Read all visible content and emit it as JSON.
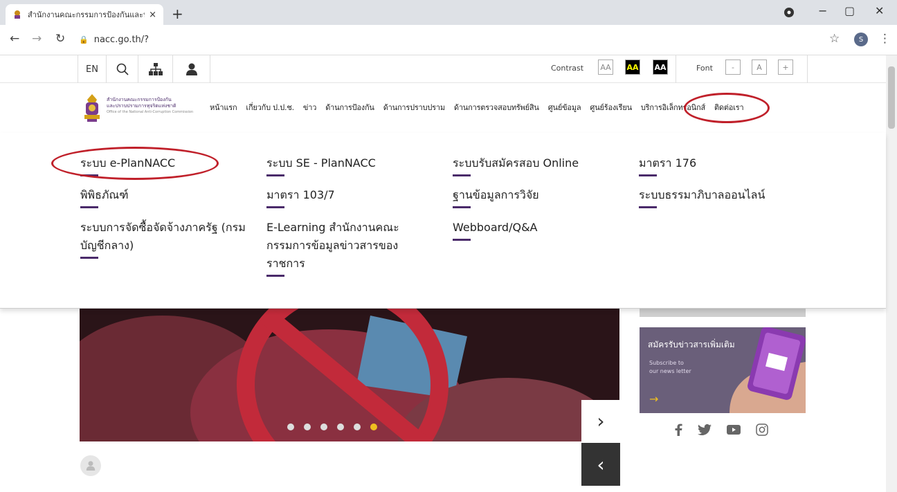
{
  "browser": {
    "tab_title": "สำนักงานคณะกรรมการป้องกันและปรา",
    "tab_close": "×",
    "new_tab": "+",
    "url": "nacc.go.th/?",
    "minimize": "−",
    "restore": "▢",
    "close": "✕",
    "profile_initial": "S"
  },
  "utility": {
    "lang": "EN",
    "contrast_label": "Contrast",
    "contrast_options": [
      "AA",
      "AA",
      "AA"
    ],
    "font_label": "Font",
    "font_options": [
      "-",
      "A",
      "+"
    ]
  },
  "logo": {
    "line1": "สำนักงานคณะกรรมการป้องกัน",
    "line2": "และปราบปรามการทุจริตแห่งชาติ",
    "line3": "Office of the National Anti-Corruption Commission"
  },
  "nav": {
    "items": [
      "หน้าแรก",
      "เกี่ยวกับ ป.ป.ช.",
      "ข่าว",
      "ด้านการป้องกัน",
      "ด้านการปราบปราม",
      "ด้านการตรวจสอบทรัพย์สิน",
      "ศูนย์ข้อมูล",
      "ศูนย์ร้องเรียน",
      "บริการอิเล็กทรอนิกส์",
      "ติดต่อเรา"
    ]
  },
  "mega": {
    "col1": [
      "ระบบ e-PlanNACC",
      "พิพิธภัณฑ์",
      "ระบบการจัดซื้อจัดจ้างภาครัฐ (กรมบัญชีกลาง)"
    ],
    "col2": [
      "ระบบ SE - PlanNACC",
      "มาตรา 103/7",
      "E-Learning สำนักงานคณะกรรมการข้อมูลข่าวสารของราชการ"
    ],
    "col3": [
      "ระบบรับสมัครสอบ Online",
      "ฐานข้อมูลการวิจัย",
      "Webboard/Q&A"
    ],
    "col4": [
      "มาตรา 176",
      "ระบบธรรมาภิบาลออนไลน์"
    ]
  },
  "side": {
    "subscribe_title": "สมัครรับข่าวสารเพิ่มเติม",
    "subscribe_en1": "Subscribe to",
    "subscribe_en2": "our news letter",
    "arrow": "→"
  },
  "colors": {
    "accent": "#4a2a6a",
    "annotation": "#c0202a",
    "indicator_active": "#f0c020"
  }
}
